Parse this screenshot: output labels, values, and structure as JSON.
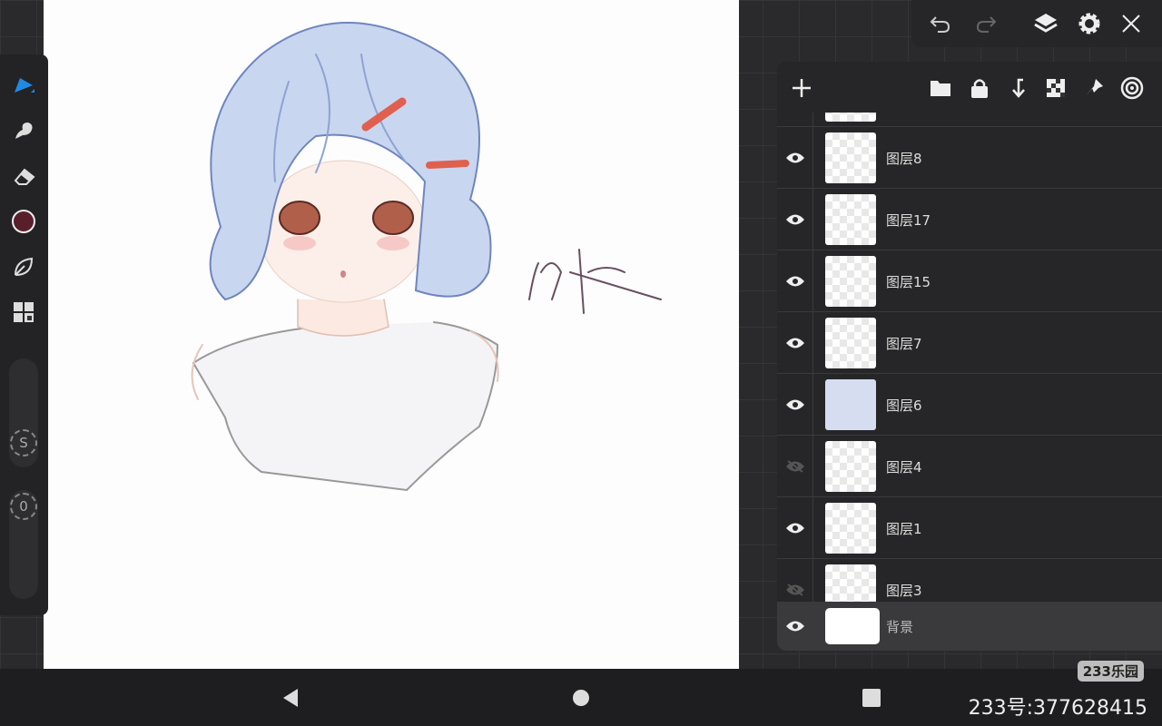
{
  "toolbar": {
    "tools": [
      "brush",
      "smudge",
      "eraser",
      "color",
      "shape",
      "gallery"
    ],
    "current_color": "#5a1e2a",
    "size_label": "S",
    "opacity_label": "0"
  },
  "topbar": {
    "icons": [
      "undo",
      "redo",
      "layers",
      "settings",
      "close"
    ]
  },
  "layers_panel": {
    "header_icons": [
      "add",
      "folder",
      "lock",
      "merge-down",
      "transparency",
      "pin",
      "target"
    ],
    "layers": [
      {
        "name": "图层8",
        "visible": true
      },
      {
        "name": "图层17",
        "visible": true
      },
      {
        "name": "图层15",
        "visible": true
      },
      {
        "name": "图层7",
        "visible": true
      },
      {
        "name": "图层6",
        "visible": true
      },
      {
        "name": "图层4",
        "visible": false
      },
      {
        "name": "图层1",
        "visible": true
      },
      {
        "name": "图层3",
        "visible": false
      }
    ],
    "background_layer": {
      "name": "背景",
      "visible": true
    }
  },
  "watermark": "233乐园",
  "user_id": "233号:377628415"
}
